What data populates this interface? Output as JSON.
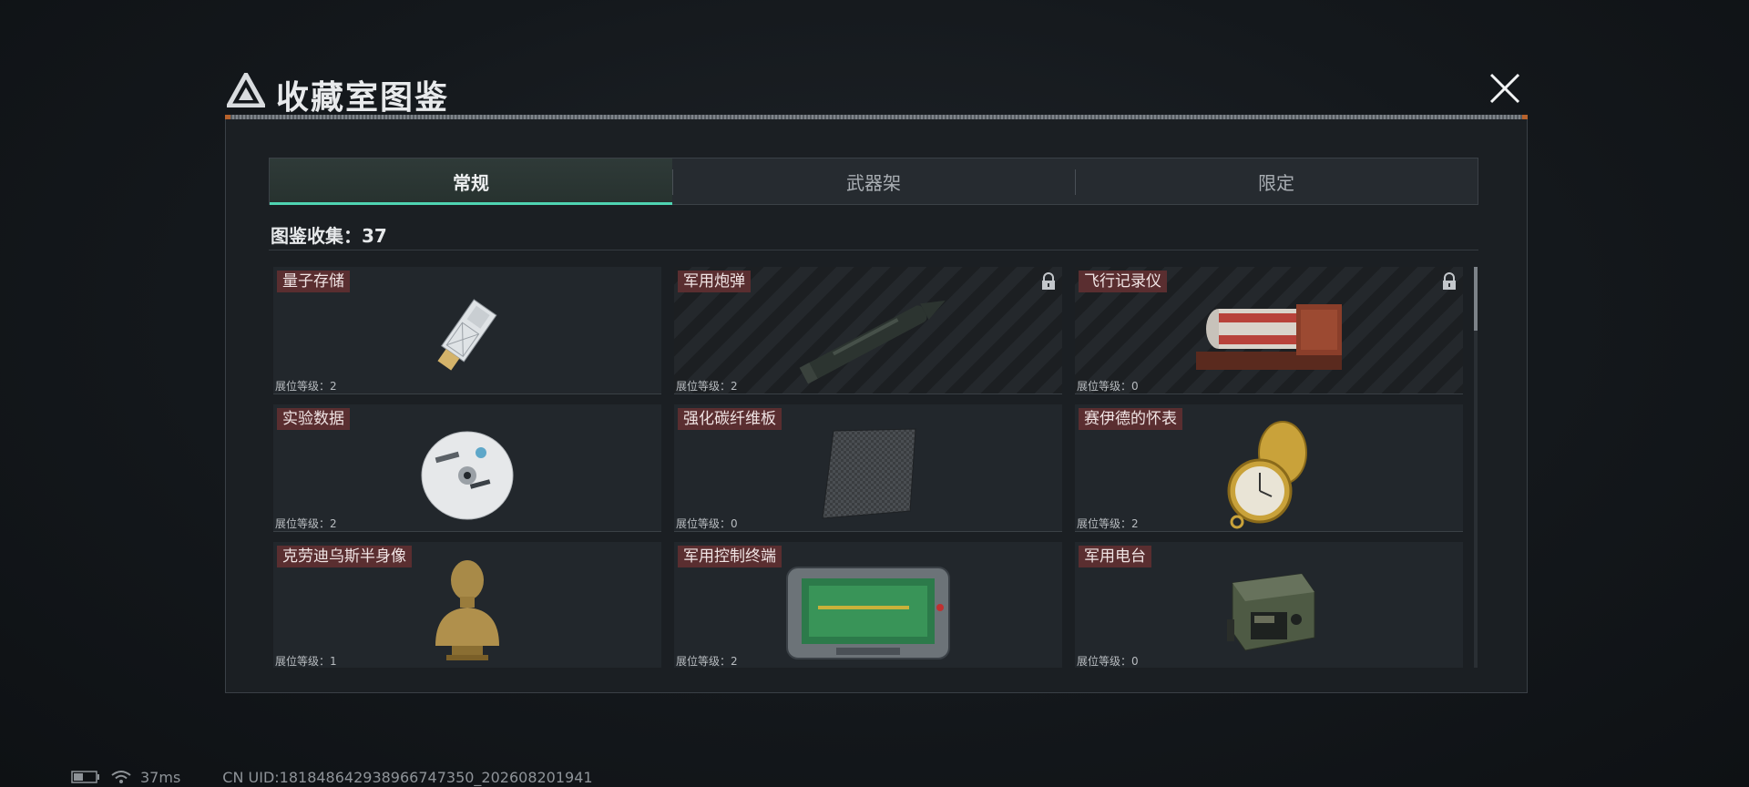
{
  "header": {
    "title": "收藏室图鉴"
  },
  "tabs": [
    {
      "label": "常规",
      "active": true
    },
    {
      "label": "武器架",
      "active": false
    },
    {
      "label": "限定",
      "active": false
    }
  ],
  "collection": {
    "label": "图鉴收集：37"
  },
  "level_prefix": "展位等级：",
  "items": [
    {
      "name": "量子存储",
      "level": "展位等级：2",
      "locked": false,
      "icon": "usb-drive-icon"
    },
    {
      "name": "军用炮弹",
      "level": "展位等级：2",
      "locked": true,
      "icon": "artillery-shell-icon"
    },
    {
      "name": "飞行记录仪",
      "level": "展位等级：0",
      "locked": true,
      "icon": "flight-recorder-icon"
    },
    {
      "name": "实验数据",
      "level": "展位等级：2",
      "locked": false,
      "icon": "cd-disc-icon"
    },
    {
      "name": "强化碳纤维板",
      "level": "展位等级：0",
      "locked": false,
      "icon": "carbon-plate-icon"
    },
    {
      "name": "赛伊德的怀表",
      "level": "展位等级：2",
      "locked": false,
      "icon": "pocket-watch-icon"
    },
    {
      "name": "克劳迪乌斯半身像",
      "level": "展位等级：1",
      "locked": false,
      "icon": "bust-statue-icon"
    },
    {
      "name": "军用控制终端",
      "level": "展位等级：2",
      "locked": false,
      "icon": "control-terminal-icon"
    },
    {
      "name": "军用电台",
      "level": "展位等级：0",
      "locked": false,
      "icon": "radio-icon"
    }
  ],
  "status": {
    "ping": "37ms",
    "uid": "CN UID:181848642938966747350_202608201941"
  },
  "colors": {
    "accent": "#4fd4b2",
    "name_tag": "#5a2e30",
    "title_line_accent": "#c96b2e"
  }
}
